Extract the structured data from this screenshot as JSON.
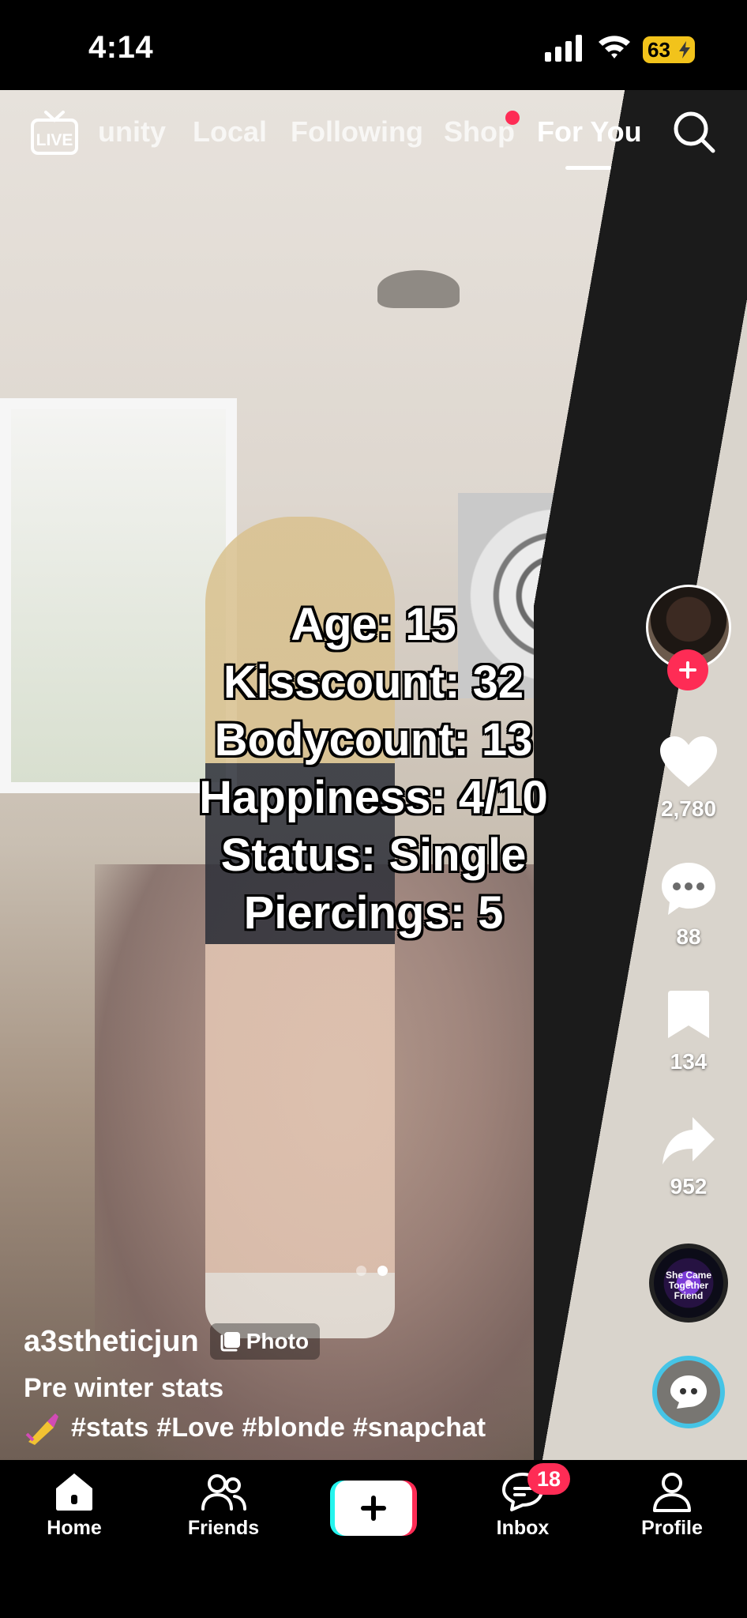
{
  "status_bar": {
    "time": "4:14",
    "battery": "63"
  },
  "top_nav": {
    "live_label": "LIVE",
    "tabs": [
      {
        "label": "Community",
        "shown_text": "unity"
      },
      {
        "label": "Local"
      },
      {
        "label": "Following"
      },
      {
        "label": "Shop"
      },
      {
        "label": "For You"
      }
    ],
    "active_tab": "For You"
  },
  "post": {
    "overlay_lines": [
      "Age: 15",
      "Kisscount: 32",
      "Bodycount: 13",
      "Happiness: 4/10",
      "Status: Single",
      "Piercings: 5"
    ],
    "username": "a3stheticjun",
    "type_badge": "Photo",
    "caption_title": "Pre winter stats",
    "hashtags": [
      "#stats",
      "#Love",
      "#blonde",
      "#snapchat"
    ],
    "emoji_icon": "nail-polish-emoji",
    "carousel": {
      "count": 2,
      "active_index": 1
    }
  },
  "actions": {
    "likes": "2,780",
    "comments": "88",
    "bookmarks": "134",
    "shares": "952",
    "music_disc_text": "She Came Together Friend"
  },
  "bottom_nav": {
    "home": "Home",
    "friends": "Friends",
    "inbox": "Inbox",
    "inbox_badge": "18",
    "profile": "Profile"
  },
  "colors": {
    "accent_red": "#fe2c55",
    "accent_cyan": "#25f4ee",
    "battery_yellow": "#f2c31b"
  }
}
